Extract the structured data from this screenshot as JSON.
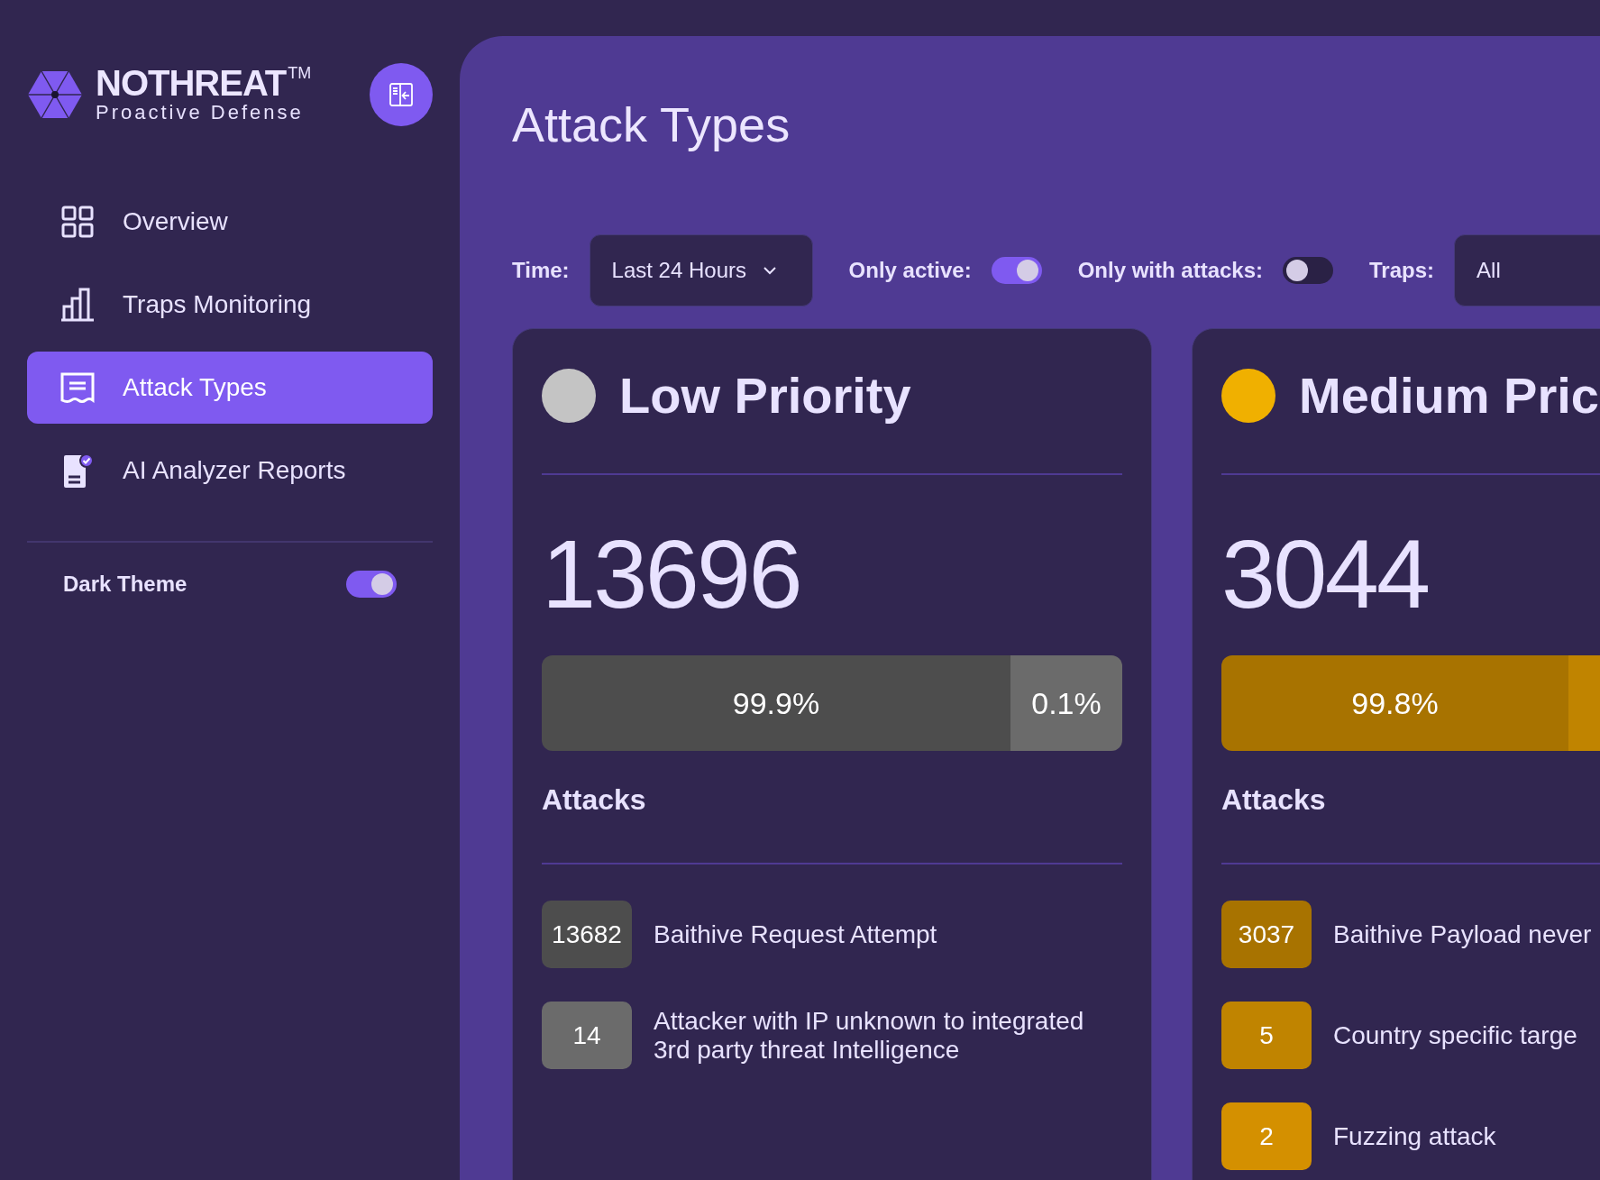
{
  "brand": {
    "name": "NOTHREAT",
    "mark": "TM",
    "tagline": "Proactive Defense"
  },
  "nav": [
    {
      "label": "Overview",
      "selected": false
    },
    {
      "label": "Traps Monitoring",
      "selected": false
    },
    {
      "label": "Attack Types",
      "selected": true
    },
    {
      "label": "AI Analyzer Reports",
      "selected": false
    }
  ],
  "theme_toggle": {
    "label": "Dark Theme",
    "on": true
  },
  "page_title": "Attack Types",
  "filters": [
    {
      "kind": "dropdown",
      "label": "Time:",
      "value": "Last 24 Hours"
    },
    {
      "kind": "toggle",
      "label": "Only active:",
      "on": true
    },
    {
      "kind": "toggle",
      "label": "Only with attacks:",
      "on": false
    },
    {
      "kind": "select",
      "label": "Traps:",
      "value": "All"
    }
  ],
  "cards": [
    {
      "title": "Low Priority",
      "color": "#c4c4c4",
      "total": "13696",
      "segments": [
        {
          "label": "99.9%",
          "color": "#4d4d4d"
        },
        {
          "label": "0.1%",
          "color": "#6b6b6b"
        }
      ],
      "attacks_heading": "Attacks",
      "attacks": [
        {
          "count": "13682",
          "label": "Baithive Request Attempt",
          "color": "#4d4d4d"
        },
        {
          "count": "14",
          "label": "Attacker with IP unknown to integrated 3rd party threat Intelligence",
          "color": "#6b6b6b"
        }
      ]
    },
    {
      "title": "Medium Pric",
      "color": "#f0b000",
      "total": "3044",
      "segments": [
        {
          "label": "99.8%",
          "color": "#a87300"
        },
        {
          "color": "#c08400"
        }
      ],
      "attacks_heading": "Attacks",
      "attacks": [
        {
          "count": "3037",
          "label": "Baithive Payload never",
          "color": "#a87300"
        },
        {
          "count": "5",
          "label": "Country specific targe",
          "color": "#c08400"
        },
        {
          "count": "2",
          "label": "Fuzzing attack",
          "color": "#d49000"
        }
      ]
    }
  ]
}
